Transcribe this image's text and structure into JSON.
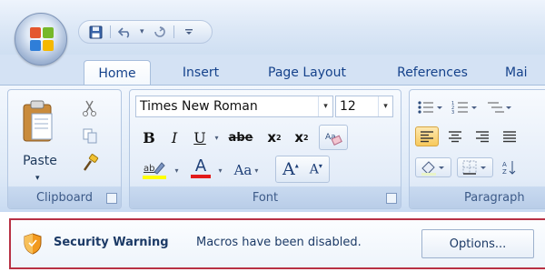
{
  "quick_access": {
    "save_icon": "save-icon",
    "undo_icon": "undo-icon",
    "redo_icon": "redo-icon",
    "customize_icon": "customize-qat-icon"
  },
  "tabs": [
    {
      "label": "Home",
      "active": true
    },
    {
      "label": "Insert",
      "active": false
    },
    {
      "label": "Page Layout",
      "active": false
    },
    {
      "label": "References",
      "active": false
    },
    {
      "label": "Mai",
      "active": false
    }
  ],
  "clipboard": {
    "paste_label": "Paste",
    "caption": "Clipboard"
  },
  "font": {
    "font_name": "Times New Roman",
    "font_size": "12",
    "bold": "B",
    "italic": "I",
    "underline": "U",
    "strike": "abe",
    "subscript": "x",
    "superscript": "x",
    "change_case": "Aa",
    "grow": "A",
    "shrink": "A",
    "font_color": "A",
    "caption": "Font"
  },
  "paragraph": {
    "caption": "Paragraph"
  },
  "message_bar": {
    "title": "Security Warning",
    "text": "Macros have been disabled.",
    "options_label": "Options...",
    "border_color": "#b83144"
  }
}
